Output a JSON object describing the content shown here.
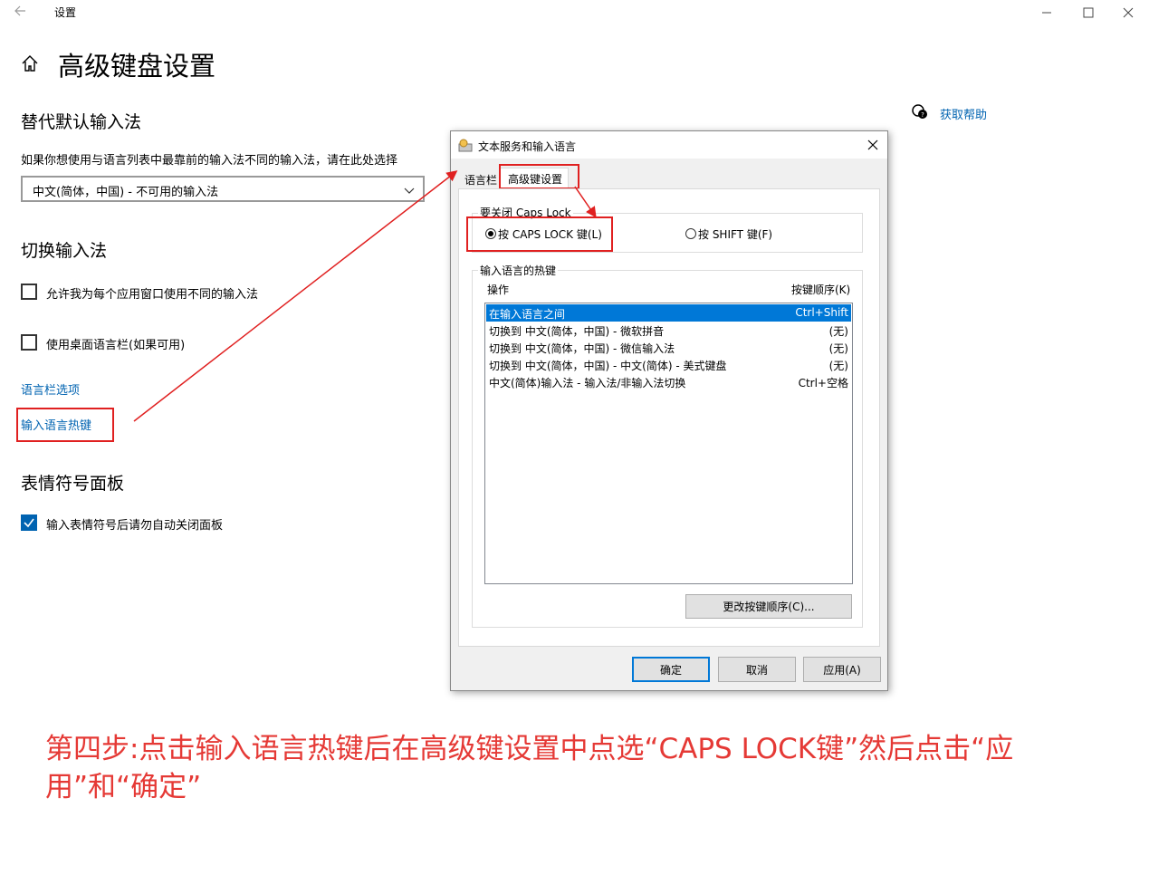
{
  "window": {
    "title": "设置"
  },
  "page": {
    "title": "高级键盘设置"
  },
  "help": {
    "label": "获取帮助"
  },
  "sections": {
    "override": {
      "heading": "替代默认输入法",
      "description": "如果你想使用与语言列表中最靠前的输入法不同的输入法，请在此处选择",
      "selected": "中文(简体，中国) - 不可用的输入法"
    },
    "switch": {
      "heading": "切换输入法",
      "option1": "允许我为每个应用窗口使用不同的输入法",
      "option2": "使用桌面语言栏(如果可用)",
      "link_langbar": "语言栏选项",
      "link_hotkeys": "输入语言热键"
    },
    "emoji": {
      "heading": "表情符号面板",
      "option": "输入表情符号后请勿自动关闭面板"
    }
  },
  "dialog": {
    "title": "文本服务和输入语言",
    "tabs": [
      "语言栏",
      "高级键设置"
    ],
    "caps_group": "要关闭 Caps Lock",
    "radio_caps": "按 CAPS LOCK 键(L)",
    "radio_shift": "按 SHIFT 键(F)",
    "hotkey_group": "输入语言的热键",
    "col_action": "操作",
    "col_order": "按键顺序(K)",
    "rows": [
      {
        "action": "在输入语言之间",
        "keys": "Ctrl+Shift"
      },
      {
        "action": "切换到 中文(简体，中国) - 微软拼音",
        "keys": "(无)"
      },
      {
        "action": "切换到 中文(简体，中国) - 微信输入法",
        "keys": "(无)"
      },
      {
        "action": "切换到 中文(简体，中国) - 中文(简体) - 美式键盘",
        "keys": "(无)"
      },
      {
        "action": "中文(简体)输入法 - 输入法/非输入法切换",
        "keys": "Ctrl+空格"
      }
    ],
    "change_button": "更改按键顺序(C)...",
    "ok": "确定",
    "cancel": "取消",
    "apply": "应用(A)"
  },
  "instruction": "第四步:点击输入语言热键后在高级键设置中点选“CAPS LOCK键”然后点击“应用”和“确定”",
  "colors": {
    "accent": "#0063b1",
    "annotation": "#e02020",
    "selection": "#0078d7"
  }
}
